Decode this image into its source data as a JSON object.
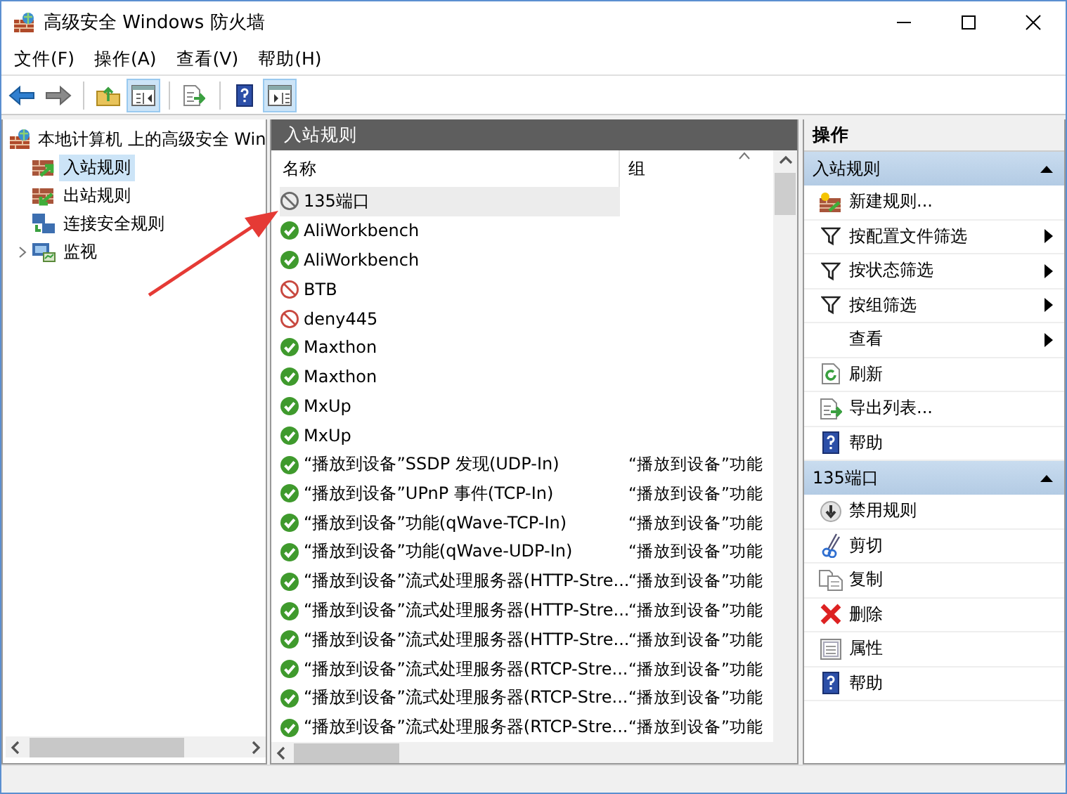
{
  "window": {
    "title": "高级安全 Windows 防火墙"
  },
  "menu": [
    "文件(F)",
    "操作(A)",
    "查看(V)",
    "帮助(H)"
  ],
  "toolbar_groups": [
    [
      {
        "kind": "back",
        "on": false
      },
      {
        "kind": "forward",
        "on": false
      }
    ],
    [
      {
        "kind": "up",
        "on": false
      },
      {
        "kind": "tree",
        "on": true
      }
    ],
    [
      {
        "kind": "export",
        "on": false
      }
    ],
    [
      {
        "kind": "help",
        "on": false
      },
      {
        "kind": "actions",
        "on": true
      }
    ]
  ],
  "tree": {
    "root": {
      "label": "本地计算机 上的高级安全 Win",
      "children": [
        {
          "label": "入站规则",
          "kind": "inbound",
          "selected": true,
          "has_children": false
        },
        {
          "label": "出站规则",
          "kind": "outbound",
          "selected": false,
          "has_children": false
        },
        {
          "label": "连接安全规则",
          "kind": "connsec",
          "selected": false,
          "has_children": false
        },
        {
          "label": "监视",
          "kind": "monitor",
          "selected": false,
          "has_children": true
        }
      ]
    }
  },
  "rules": {
    "title": "入站规则",
    "columns": [
      "名称",
      "组"
    ],
    "rows": [
      {
        "name": "135端口",
        "kind": "block",
        "enabled": false,
        "selected": true
      },
      {
        "name": "AliWorkbench",
        "kind": "allow",
        "enabled": true,
        "selected": false
      },
      {
        "name": "AliWorkbench",
        "kind": "allow",
        "enabled": true,
        "selected": false
      },
      {
        "name": "BTB",
        "kind": "block",
        "enabled": true,
        "selected": false
      },
      {
        "name": "deny445",
        "kind": "block",
        "enabled": true,
        "selected": false
      },
      {
        "name": "Maxthon",
        "kind": "allow",
        "enabled": true,
        "selected": false
      },
      {
        "name": "Maxthon",
        "kind": "allow",
        "enabled": true,
        "selected": false
      },
      {
        "name": "MxUp",
        "kind": "allow",
        "enabled": true,
        "selected": false
      },
      {
        "name": "MxUp",
        "kind": "allow",
        "enabled": true,
        "selected": false
      },
      {
        "name": "“播放到设备”SSDP 发现(UDP-In)",
        "group": "“播放到设备”功能",
        "kind": "allow",
        "enabled": true,
        "selected": false
      },
      {
        "name": "“播放到设备”UPnP 事件(TCP-In)",
        "group": "“播放到设备”功能",
        "kind": "allow",
        "enabled": true,
        "selected": false
      },
      {
        "name": "“播放到设备”功能(qWave-TCP-In)",
        "group": "“播放到设备”功能",
        "kind": "allow",
        "enabled": true,
        "selected": false
      },
      {
        "name": "“播放到设备”功能(qWave-UDP-In)",
        "group": "“播放到设备”功能",
        "kind": "allow",
        "enabled": true,
        "selected": false
      },
      {
        "name": "“播放到设备”流式处理服务器(HTTP-Stre...",
        "group": "“播放到设备”功能",
        "kind": "allow",
        "enabled": true,
        "selected": false
      },
      {
        "name": "“播放到设备”流式处理服务器(HTTP-Stre...",
        "group": "“播放到设备”功能",
        "kind": "allow",
        "enabled": true,
        "selected": false
      },
      {
        "name": "“播放到设备”流式处理服务器(HTTP-Stre...",
        "group": "“播放到设备”功能",
        "kind": "allow",
        "enabled": true,
        "selected": false
      },
      {
        "name": "“播放到设备”流式处理服务器(RTCP-Stre...",
        "group": "“播放到设备”功能",
        "kind": "allow",
        "enabled": true,
        "selected": false
      },
      {
        "name": "“播放到设备”流式处理服务器(RTCP-Stre...",
        "group": "“播放到设备”功能",
        "kind": "allow",
        "enabled": true,
        "selected": false
      },
      {
        "name": "“播放到设备”流式处理服务器(RTCP-Stre...",
        "group": "“播放到设备”功能",
        "kind": "allow",
        "enabled": true,
        "selected": false
      }
    ]
  },
  "actions": {
    "title": "操作",
    "sections": [
      {
        "title": "入站规则",
        "expanded": true,
        "items": [
          {
            "label": "新建规则...",
            "kind": "new-rule",
            "submenu": false
          },
          {
            "label": "按配置文件筛选",
            "kind": "filter",
            "submenu": true
          },
          {
            "label": "按状态筛选",
            "kind": "filter",
            "submenu": true
          },
          {
            "label": "按组筛选",
            "kind": "filter",
            "submenu": true
          },
          {
            "label": "查看",
            "kind": "none",
            "submenu": true
          },
          {
            "label": "刷新",
            "kind": "refresh",
            "submenu": false
          },
          {
            "label": "导出列表...",
            "kind": "export",
            "submenu": false
          },
          {
            "label": "帮助",
            "kind": "help",
            "submenu": false
          }
        ]
      },
      {
        "title": "135端口",
        "expanded": true,
        "items": [
          {
            "label": "禁用规则",
            "kind": "disable",
            "submenu": false
          },
          {
            "label": "剪切",
            "kind": "cut",
            "submenu": false
          },
          {
            "label": "复制",
            "kind": "copy",
            "submenu": false
          },
          {
            "label": "删除",
            "kind": "delete",
            "submenu": false
          },
          {
            "label": "属性",
            "kind": "properties",
            "submenu": false
          },
          {
            "label": "帮助",
            "kind": "help",
            "submenu": false
          }
        ]
      }
    ]
  }
}
